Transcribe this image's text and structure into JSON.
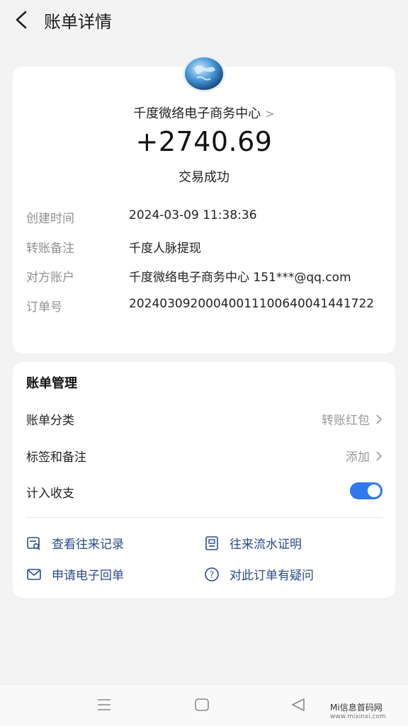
{
  "header": {
    "title": "账单详情",
    "back_icon": "chevron-left-icon"
  },
  "summary": {
    "logo_icon": "globe-logo-icon",
    "merchant": "千度微络电子商务中心",
    "merchant_chevron": ">",
    "amount": "+2740.69",
    "status": "交易成功"
  },
  "details": [
    {
      "label": "创建时间",
      "value": "2024-03-09 11:38:36"
    },
    {
      "label": "转账备注",
      "value": "千度人脉提现"
    },
    {
      "label": "对方账户",
      "value": "千度微络电子商务中心 151***@qq.com"
    },
    {
      "label": "订单号",
      "value": "20240309200040011100640041441722"
    }
  ],
  "management": {
    "title": "账单管理",
    "category_label": "账单分类",
    "category_value": "转账红包",
    "tags_label": "标签和备注",
    "tags_value": "添加",
    "count_label": "计入收支",
    "count_enabled": true,
    "accent_color": "#2f78ee"
  },
  "links": [
    {
      "label": "查看往来记录",
      "icon": "records-search-icon"
    },
    {
      "label": "往来流水证明",
      "icon": "statement-proof-icon"
    },
    {
      "label": "申请电子回单",
      "icon": "mail-icon"
    },
    {
      "label": "对此订单有疑问",
      "icon": "question-icon"
    }
  ],
  "nav": {
    "menu_icon": "menu-icon",
    "home_icon": "home-square-icon",
    "back_icon": "triangle-back-icon"
  },
  "watermark": {
    "line1": "Mi信息首码网",
    "line2": "www.mixinxi.com"
  }
}
